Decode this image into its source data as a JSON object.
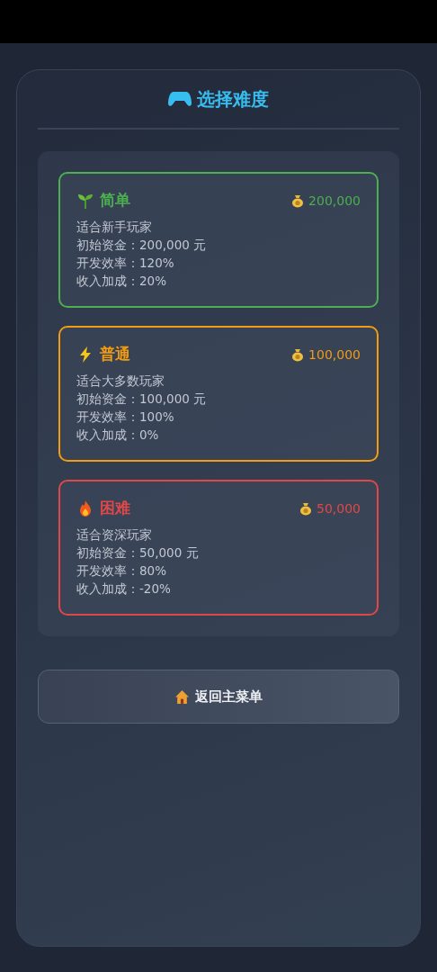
{
  "title": "选择难度",
  "difficulties": [
    {
      "kind": "sprout",
      "name": "简单",
      "color": "#4caf50",
      "funds": "200,000",
      "lines": [
        "适合新手玩家",
        "初始资金：200,000 元",
        "开发效率：120%",
        "收入加成：20%"
      ]
    },
    {
      "kind": "bolt",
      "name": "普通",
      "color": "#f39c12",
      "funds": "100,000",
      "lines": [
        "适合大多数玩家",
        "初始资金：100,000 元",
        "开发效率：100%",
        "收入加成：0%"
      ]
    },
    {
      "kind": "fire",
      "name": "困难",
      "color": "#e04848",
      "funds": "50,000",
      "lines": [
        "适合资深玩家",
        "初始资金：50,000 元",
        "开发效率：80%",
        "收入加成：-20%"
      ]
    }
  ],
  "back_button": "返回主菜单"
}
